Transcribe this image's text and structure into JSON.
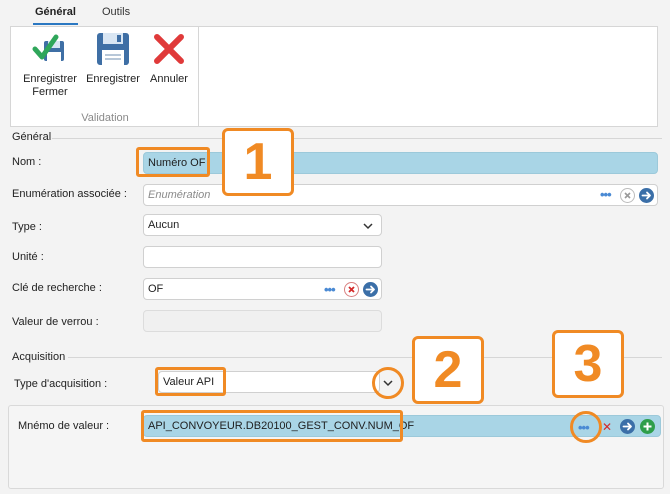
{
  "tabs": {
    "active": "Général",
    "inactive": "Outils"
  },
  "ribbon": {
    "save_close_label": "Enregistrer\nFermer",
    "save_label": "Enregistrer",
    "cancel_label": "Annuler",
    "group_label": "Validation"
  },
  "general": {
    "section_title": "Général",
    "name_label": "Nom :",
    "name_value": "Numéro OF",
    "enum_label": "Enumération associée :",
    "enum_placeholder": "Enumération",
    "type_label": "Type :",
    "type_value": "Aucun",
    "unit_label": "Unité :",
    "unit_value": "",
    "key_label": "Clé de recherche :",
    "key_value": "OF",
    "lock_label": "Valeur de verrou :",
    "lock_value": ""
  },
  "acquisition": {
    "section_title": "Acquisition",
    "type_label": "Type d'acquisition :",
    "type_value": "Valeur API",
    "mnemo_label": "Mnémo de valeur :",
    "mnemo_value": "API_CONVOYEUR.DB20100_GEST_CONV.NUM_OF"
  },
  "annotations": {
    "one": "1",
    "two": "2",
    "three": "3"
  },
  "icons": {
    "save_close": "save-check-icon",
    "save": "floppy-disk-icon",
    "cancel": "red-x-icon",
    "browse": "ellipsis-icon",
    "clear": "clear-x-icon",
    "go": "arrow-right-icon",
    "add": "plus-icon",
    "dropdown": "chevron-down-icon"
  },
  "colors": {
    "accent": "#2b78c2",
    "highlight_field": "#a9d5e6",
    "annotation": "#f08a24",
    "cancel_red": "#d42a2a",
    "go_blue": "#3b6fa8",
    "add_green": "#2e9e4a"
  }
}
